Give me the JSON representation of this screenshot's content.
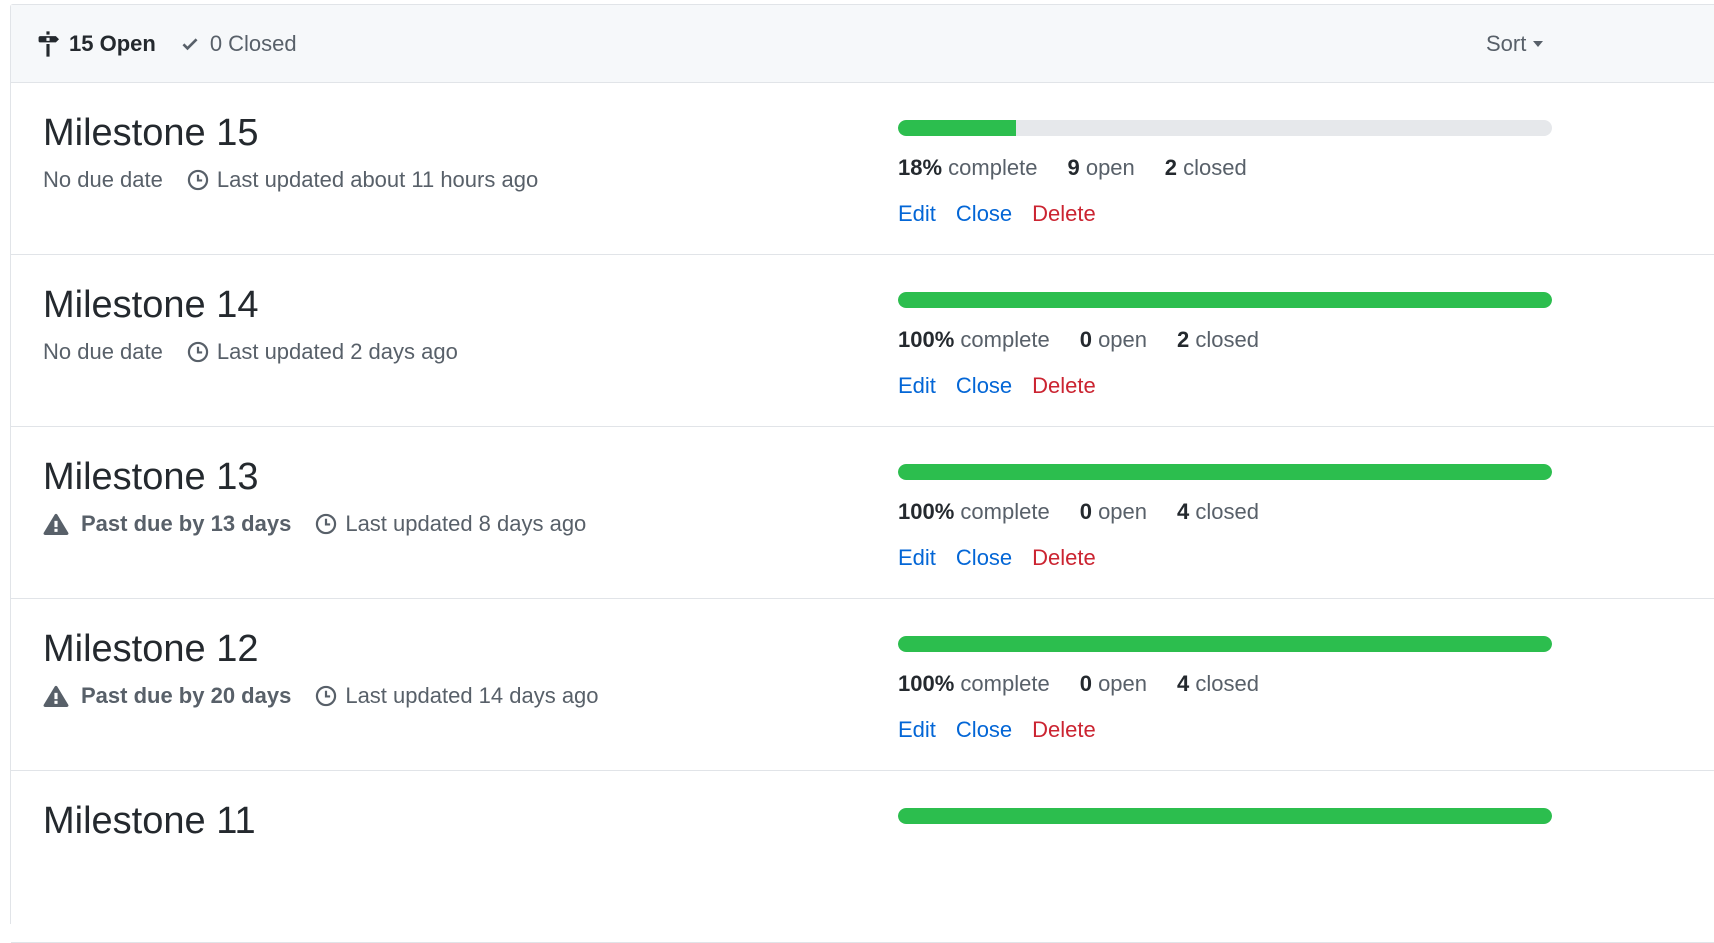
{
  "header": {
    "open_label": "15 Open",
    "closed_label": "0 Closed",
    "sort_label": "Sort"
  },
  "colors": {
    "progress_fill": "#2cbe4e",
    "progress_track": "#e6e8eb",
    "link": "#0366d6",
    "danger": "#cb2431"
  },
  "milestones": [
    {
      "title": "Milestone 15",
      "due": "No due date",
      "past_due": false,
      "updated": "Last updated about 11 hours ago",
      "percent": 18,
      "percent_text": "18%",
      "complete_word": "complete",
      "open_count": "9",
      "open_word": "open",
      "closed_count": "2",
      "closed_word": "closed",
      "edit": "Edit",
      "close": "Close",
      "delete": "Delete"
    },
    {
      "title": "Milestone 14",
      "due": "No due date",
      "past_due": false,
      "updated": "Last updated 2 days ago",
      "percent": 100,
      "percent_text": "100%",
      "complete_word": "complete",
      "open_count": "0",
      "open_word": "open",
      "closed_count": "2",
      "closed_word": "closed",
      "edit": "Edit",
      "close": "Close",
      "delete": "Delete"
    },
    {
      "title": "Milestone 13",
      "due": "Past due by 13 days",
      "past_due": true,
      "updated": "Last updated 8 days ago",
      "percent": 100,
      "percent_text": "100%",
      "complete_word": "complete",
      "open_count": "0",
      "open_word": "open",
      "closed_count": "4",
      "closed_word": "closed",
      "edit": "Edit",
      "close": "Close",
      "delete": "Delete"
    },
    {
      "title": "Milestone 12",
      "due": "Past due by 20 days",
      "past_due": true,
      "updated": "Last updated 14 days ago",
      "percent": 100,
      "percent_text": "100%",
      "complete_word": "complete",
      "open_count": "0",
      "open_word": "open",
      "closed_count": "4",
      "closed_word": "closed",
      "edit": "Edit",
      "close": "Close",
      "delete": "Delete"
    },
    {
      "title": "Milestone 11",
      "percent": 100
    }
  ]
}
